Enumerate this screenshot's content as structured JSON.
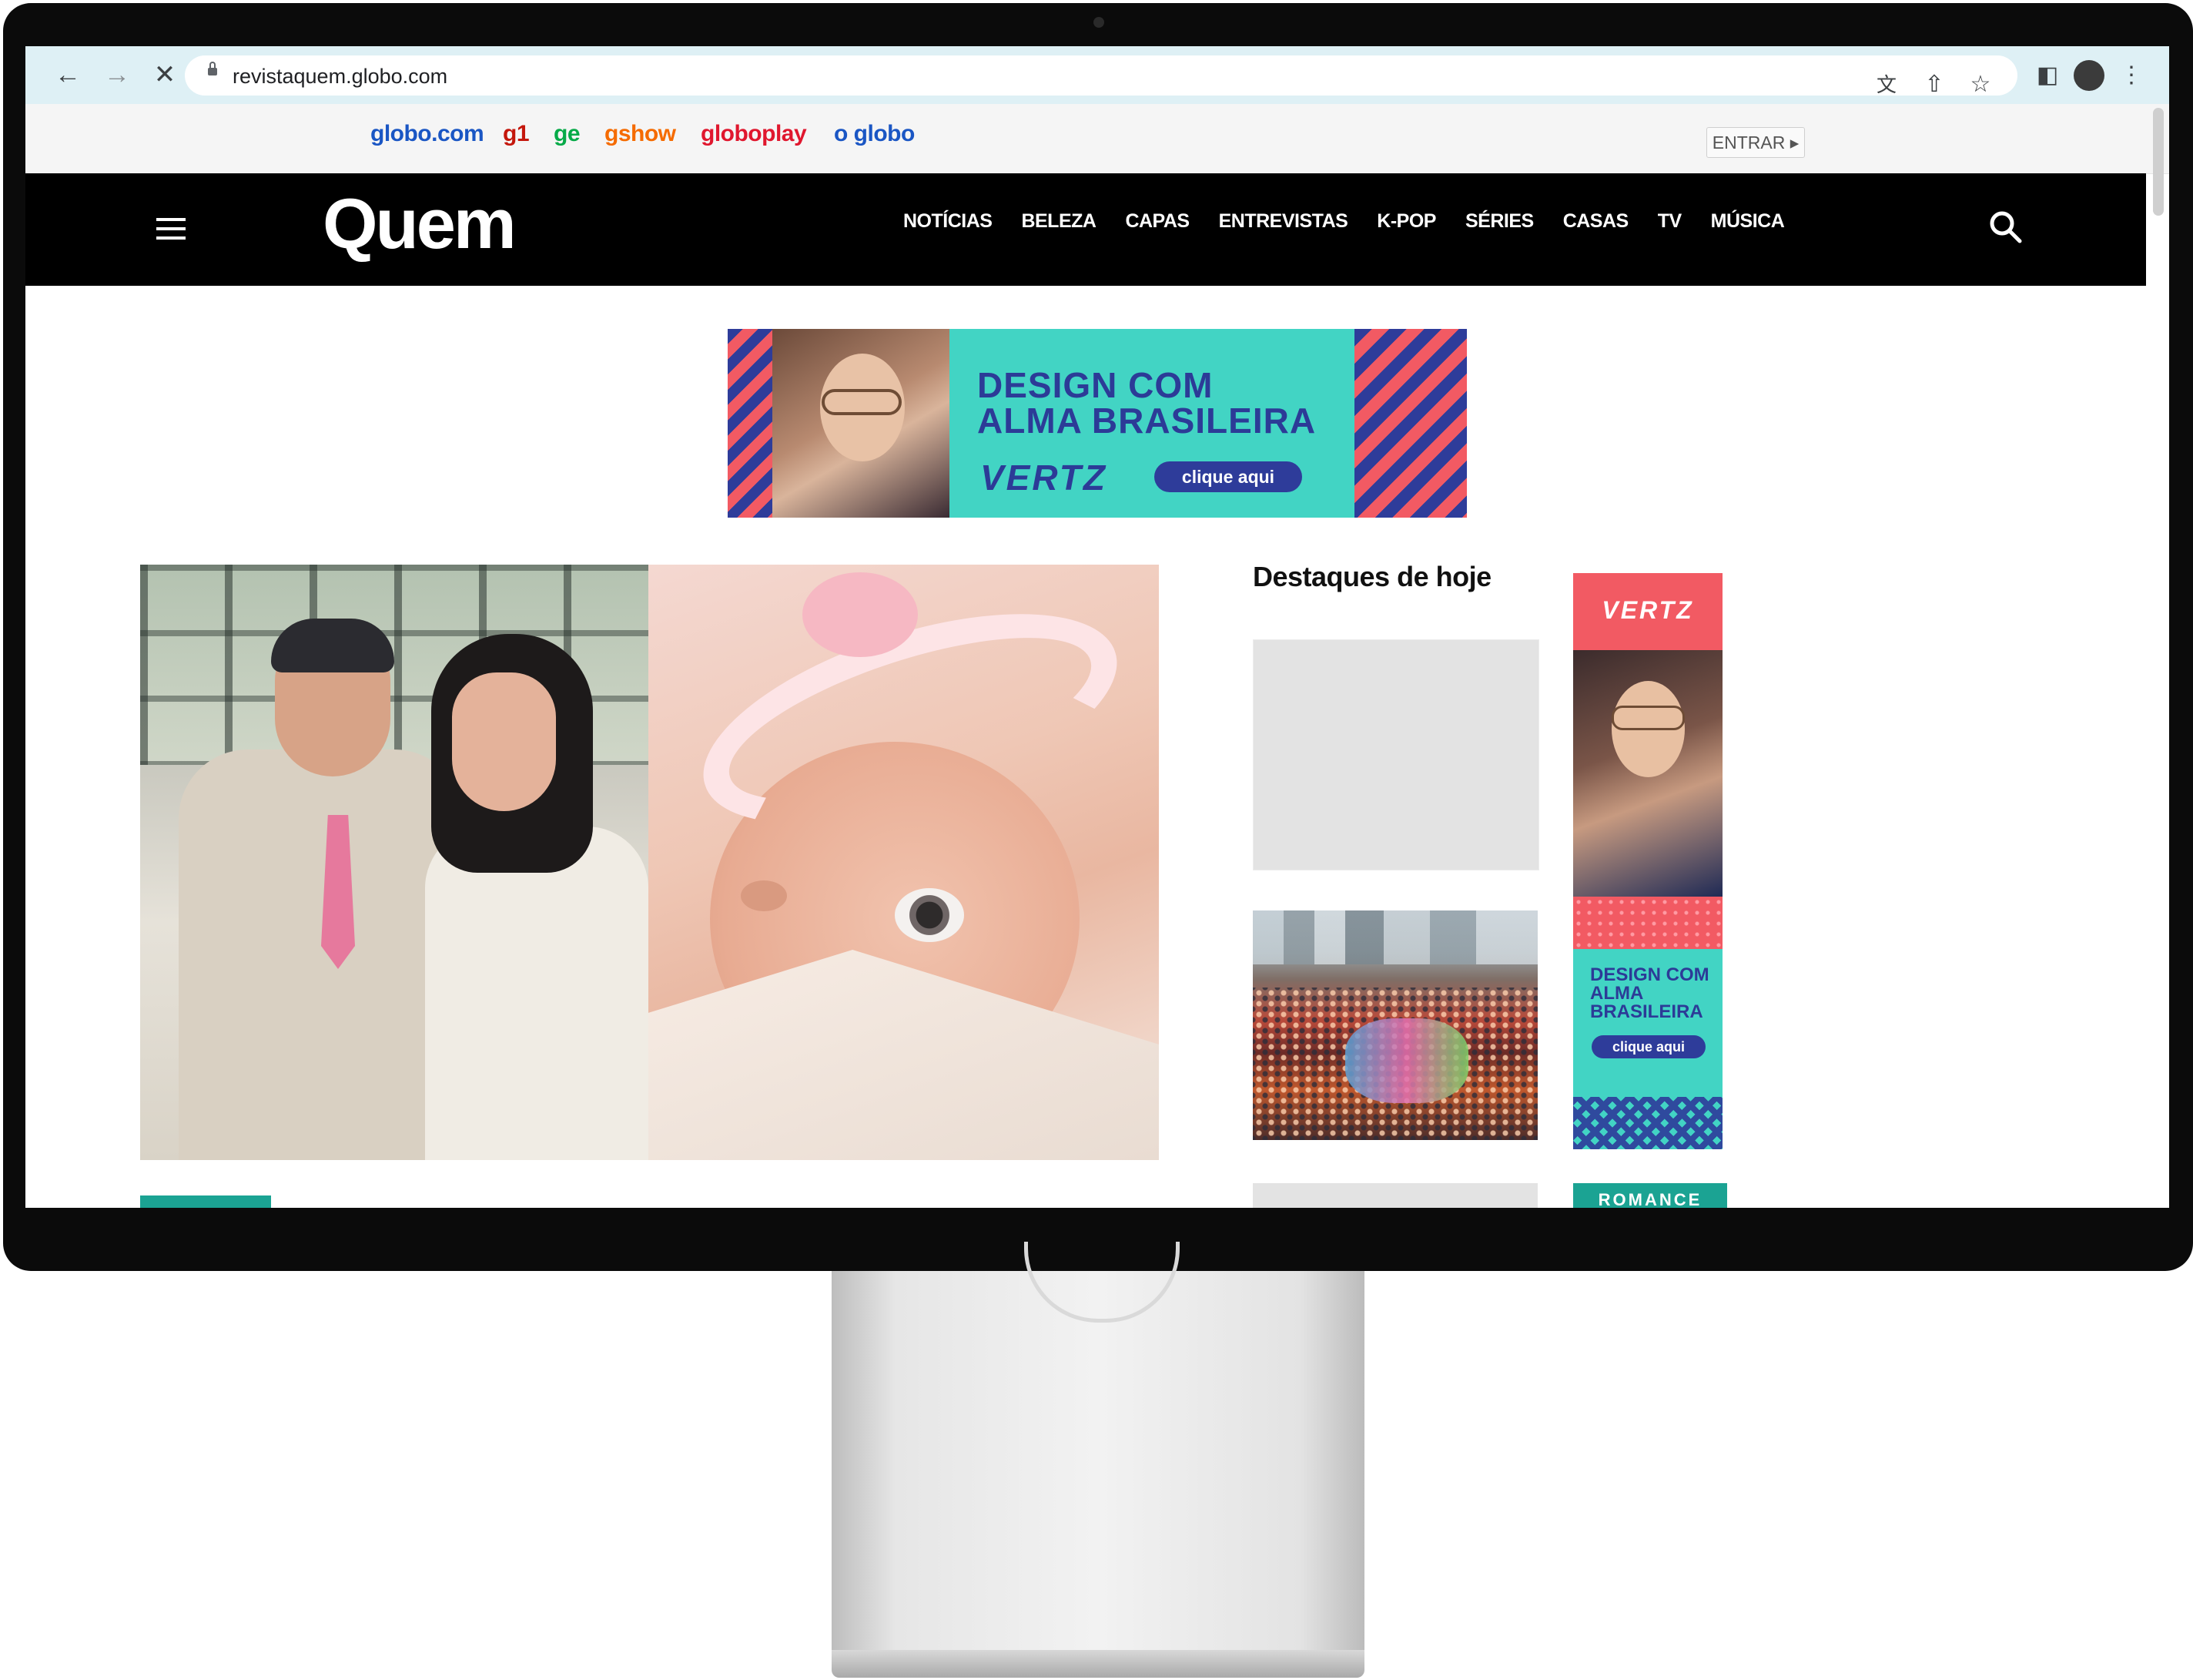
{
  "browser": {
    "url": "revistaquem.globo.com",
    "back_icon": "arrow-left-icon",
    "forward_icon": "arrow-right-icon",
    "stop_icon": "close-icon"
  },
  "globobar": {
    "brands": [
      {
        "label": "globo.com",
        "color": "#1a56c4"
      },
      {
        "label": "g1",
        "color": "#c4170c"
      },
      {
        "label": "ge",
        "color": "#06aa48"
      },
      {
        "label": "gshow",
        "color": "#f56b00"
      },
      {
        "label": "globoplay",
        "color": "#e0172e"
      },
      {
        "label": "o globo",
        "color": "#1a56c4"
      }
    ],
    "login_label": "ENTRAR ▸"
  },
  "header": {
    "logo": "Quem",
    "nav": [
      "NOTÍCIAS",
      "BELEZA",
      "CAPAS",
      "ENTREVISTAS",
      "K-POP",
      "SÉRIES",
      "CASAS",
      "TV",
      "MÚSICA"
    ]
  },
  "top_ad": {
    "headline_line1": "DESIGN COM",
    "headline_line2": "ALMA BRASILEIRA",
    "brand": "VERTZ",
    "cta": "clique aqui"
  },
  "sidebar": {
    "title": "Destaques de hoje"
  },
  "side_ad": {
    "brand": "VERTZ",
    "text": "DESIGN COM ALMA BRASILEIRA",
    "cta": "clique aqui",
    "tag": "ROMANCE"
  },
  "colors": {
    "header_bg": "#000000",
    "ad_teal": "#42d4c4",
    "ad_navy": "#2e3c9a",
    "ad_coral": "#f25a63",
    "tag_teal": "#1ba393"
  }
}
